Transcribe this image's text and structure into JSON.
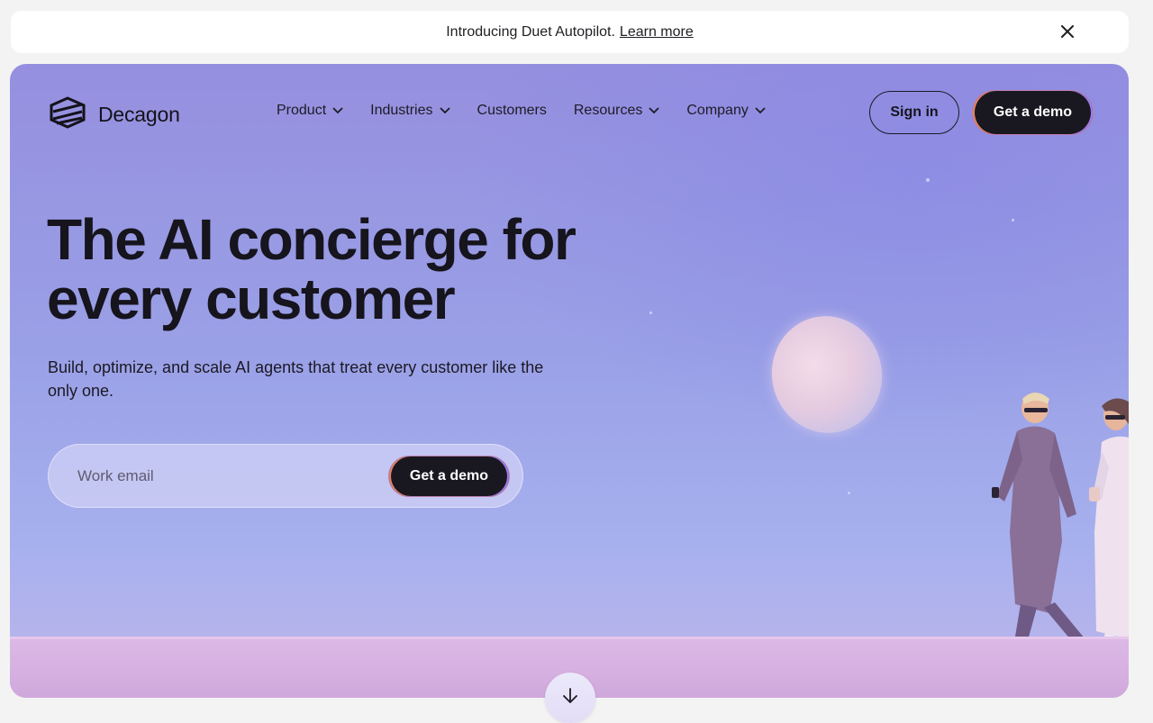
{
  "announcement": {
    "text": "Introducing Duet Autopilot.",
    "link_label": "Learn more"
  },
  "brand": {
    "name": "Decagon"
  },
  "nav": {
    "items": [
      {
        "label": "Product",
        "has_dropdown": true
      },
      {
        "label": "Industries",
        "has_dropdown": true
      },
      {
        "label": "Customers",
        "has_dropdown": false
      },
      {
        "label": "Resources",
        "has_dropdown": true
      },
      {
        "label": "Company",
        "has_dropdown": true
      }
    ],
    "sign_in_label": "Sign in",
    "demo_label": "Get a demo"
  },
  "hero": {
    "headline_line1": "The AI concierge for",
    "headline_line2": "every customer",
    "subhead": "Build, optimize, and scale AI agents that treat every customer like the only one.",
    "email_placeholder": "Work email",
    "email_value": "",
    "cta_label": "Get a demo"
  },
  "icons": {
    "close": "close-icon",
    "chevron": "chevron-down-icon",
    "scroll": "arrow-down-icon",
    "logo": "decagon-logo-icon"
  },
  "colors": {
    "hero_sky": "#958fdf",
    "button_dark": "#191820",
    "button_accent_warm": "#e98763",
    "button_accent_cool": "#9b7df0",
    "ground": "#dcb9e6"
  }
}
